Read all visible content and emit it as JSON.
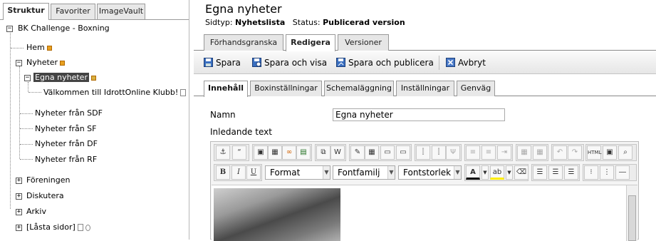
{
  "left": {
    "tabs": [
      "Struktur",
      "Favoriter",
      "ImageVault"
    ],
    "tree": {
      "root": "BK Challenge - Boxning",
      "hem": "Hem",
      "nyheter": "Nyheter",
      "egna": "Egna nyheter",
      "valkommen": "Välkommen till IdrottOnline Klubb!",
      "sdf": "Nyheter från SDF",
      "sf": "Nyheter från SF",
      "df": "Nyheter från DF",
      "rf": "Nyheter från RF",
      "foreningen": "Föreningen",
      "diskutera": "Diskutera",
      "arkiv": "Arkiv",
      "lasta": "[Låsta sidor]"
    }
  },
  "page": {
    "title": "Egna nyheter",
    "meta": {
      "type_label": "Sidtyp:",
      "type_value": "Nyhetslista",
      "status_label": "Status:",
      "status_value": "Publicerad version"
    },
    "tabs": [
      "Förhandsgranska",
      "Redigera",
      "Versioner"
    ],
    "toolbar": {
      "save": "Spara",
      "save_view": "Spara och visa",
      "save_publish": "Spara och publicera",
      "cancel": "Avbryt"
    },
    "subtabs": [
      "Innehåll",
      "Boxinställningar",
      "Schemaläggning",
      "Inställningar",
      "Genväg"
    ],
    "form": {
      "name_label": "Namn",
      "name_value": "Egna nyheter",
      "intro_label": "Inledande text"
    },
    "editor": {
      "format": "Format",
      "fontfamily": "Fontfamilj",
      "fontsize": "Fontstorlek",
      "bold": "B",
      "italic": "I",
      "underline": "U",
      "html": "HTML"
    }
  },
  "colors": {
    "selection": "#444444",
    "toolbar_bg": "#e6e6e6"
  }
}
